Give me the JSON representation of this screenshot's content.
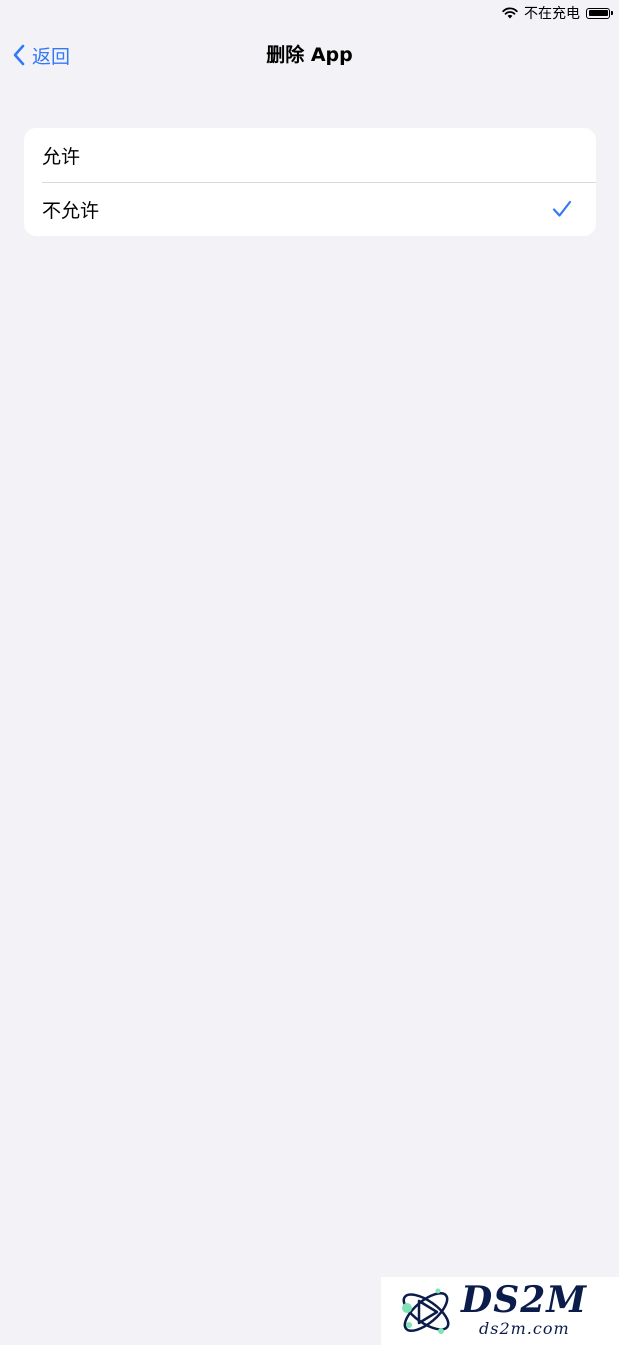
{
  "status_bar": {
    "charging_text": "不在充电",
    "icons": [
      "wifi-icon",
      "battery-icon"
    ]
  },
  "nav": {
    "back_label": "返回",
    "title": "删除 App"
  },
  "options": [
    {
      "label": "允许",
      "selected": false
    },
    {
      "label": "不允许",
      "selected": true
    }
  ],
  "watermark": {
    "logo_text": "DS2M",
    "logo_url": "ds2m.com"
  },
  "colors": {
    "background": "#f2f2f7",
    "accent": "#3478f6",
    "card": "#ffffff"
  }
}
